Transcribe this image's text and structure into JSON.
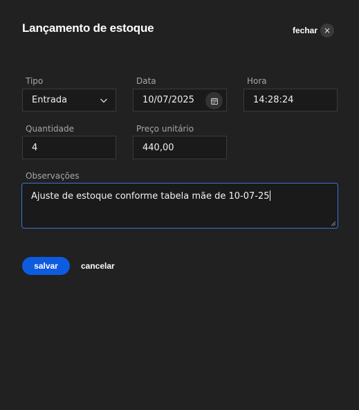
{
  "dialog": {
    "title": "Lançamento de estoque",
    "close_label": "fechar",
    "close_icon": "×"
  },
  "form": {
    "tipo": {
      "label": "Tipo",
      "value": "Entrada"
    },
    "data": {
      "label": "Data",
      "value": "10/07/2025"
    },
    "hora": {
      "label": "Hora",
      "value": "14:28:24"
    },
    "quantidade": {
      "label": "Quantidade",
      "value": "4"
    },
    "preco": {
      "label": "Preço unitário",
      "value": "440,00"
    },
    "observacoes": {
      "label": "Observações",
      "value": "Ajuste de estoque conforme tabela mãe de 10-07-25"
    }
  },
  "actions": {
    "save_label": "salvar",
    "cancel_label": "cancelar"
  },
  "colors": {
    "background": "#212121",
    "accent": "#0d5be0",
    "focus_border": "#3b73d6"
  }
}
